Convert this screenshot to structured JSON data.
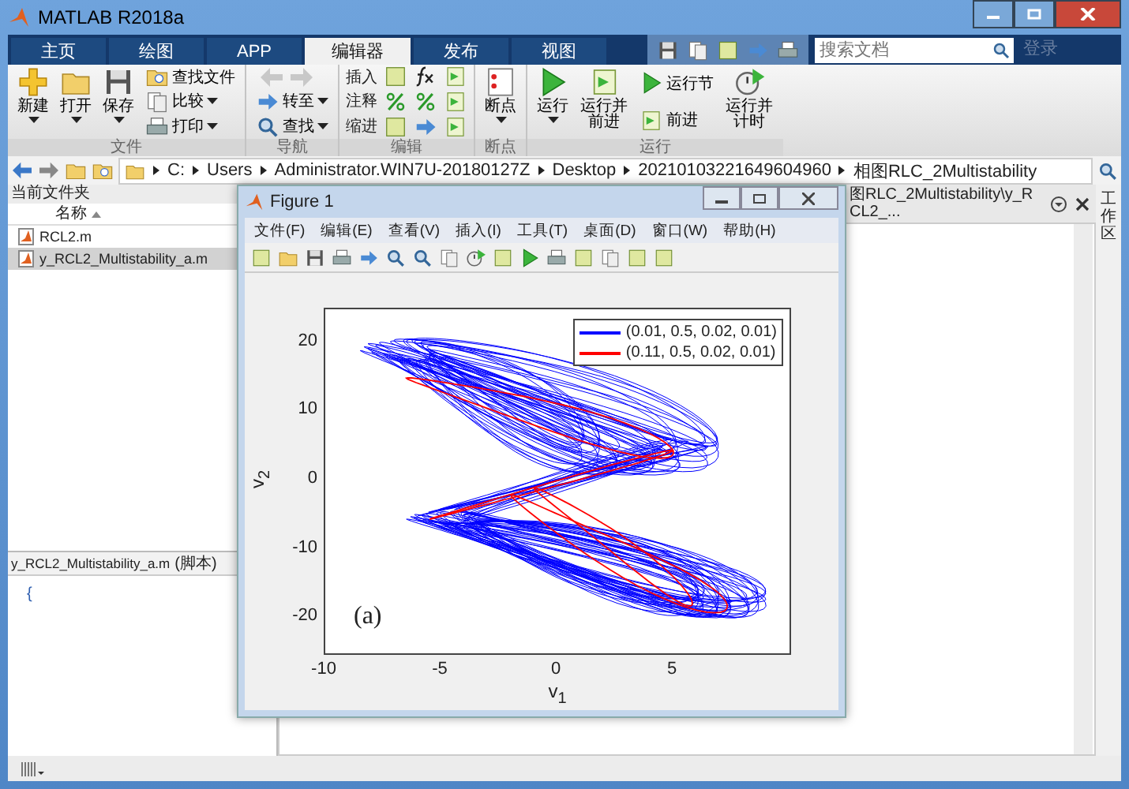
{
  "window": {
    "title": "MATLAB R2018a"
  },
  "ribbon_tabs": [
    {
      "label": "主页",
      "selected": false
    },
    {
      "label": "绘图",
      "selected": false
    },
    {
      "label": "APP",
      "selected": false
    },
    {
      "label": "编辑器",
      "selected": true
    },
    {
      "label": "发布",
      "selected": false
    },
    {
      "label": "视图",
      "selected": false
    }
  ],
  "search": {
    "placeholder": "搜索文档"
  },
  "login": "登录",
  "ribbon_groups": [
    {
      "label": "文件",
      "items": [
        {
          "kind": "large",
          "label": "新建",
          "dropdown": true
        },
        {
          "kind": "large",
          "label": "打开",
          "dropdown": true
        },
        {
          "kind": "large",
          "label": "保存",
          "dropdown": true
        },
        {
          "kind": "column",
          "rows": [
            {
              "label": "查找文件",
              "dropdown": false
            },
            {
              "label": "比较",
              "dropdown": true
            },
            {
              "label": "打印",
              "dropdown": true
            }
          ]
        }
      ]
    },
    {
      "label": "导航",
      "items": [
        {
          "kind": "nav",
          "rows": [
            {
              "label": "转至",
              "dropdown": true
            },
            {
              "label": "查找",
              "dropdown": true
            }
          ]
        }
      ]
    },
    {
      "label": "编辑",
      "items": [
        {
          "kind": "editor",
          "rows": [
            {
              "label": "插入"
            },
            {
              "label": "注释"
            },
            {
              "label": "缩进"
            }
          ]
        }
      ]
    },
    {
      "label": "断点",
      "items": [
        {
          "kind": "large",
          "label": "断点",
          "dropdown": true
        }
      ]
    },
    {
      "label": "运行",
      "items": [
        {
          "kind": "large",
          "label": "运行",
          "dropdown": true
        },
        {
          "kind": "large",
          "label": "运行并前进",
          "dropdown": false
        },
        {
          "kind": "column",
          "rows": [
            {
              "label": "运行节",
              "dropdown": false
            },
            {
              "label": "前进",
              "dropdown": false
            }
          ]
        },
        {
          "kind": "large",
          "label": "运行并计时",
          "dropdown": false
        }
      ]
    }
  ],
  "address": [
    "C:",
    "Users",
    "Administrator.WIN7U-20180127Z",
    "Desktop",
    "20210103221649604960",
    "相图RLC_2Multistability"
  ],
  "current_folder": {
    "title": "当前文件夹",
    "column": "名称",
    "files": [
      {
        "name": "RCL2.m",
        "selected": false
      },
      {
        "name": "y_RCL2_Multistability_a.m",
        "selected": true
      }
    ]
  },
  "details": {
    "title": "y_RCL2_Multistability_a.m",
    "suffix": "(脚本)",
    "content": "{"
  },
  "editor": {
    "tab_path": "图RLC_2Multistability\\y_RCL2_..."
  },
  "side_tab": "工作区",
  "figure": {
    "title": "Figure 1",
    "menu": [
      "文件(F)",
      "编辑(E)",
      "查看(V)",
      "插入(I)",
      "工具(T)",
      "桌面(D)",
      "窗口(W)",
      "帮助(H)"
    ],
    "plot": {
      "legend": [
        {
          "label": "(0.01, 0.5, 0.02, 0.01)",
          "color": "#0000ff"
        },
        {
          "label": "(0.11, 0.5, 0.02, 0.01)",
          "color": "#ff0000"
        }
      ],
      "x_ticks": [
        "-10",
        "-5",
        "0",
        "5"
      ],
      "y_ticks": [
        "20",
        "10",
        "0",
        "-10",
        "-20"
      ],
      "xlabel": "v$_{1}$",
      "ylabel": "v$_{2}$",
      "annotation": "(a)"
    }
  }
}
